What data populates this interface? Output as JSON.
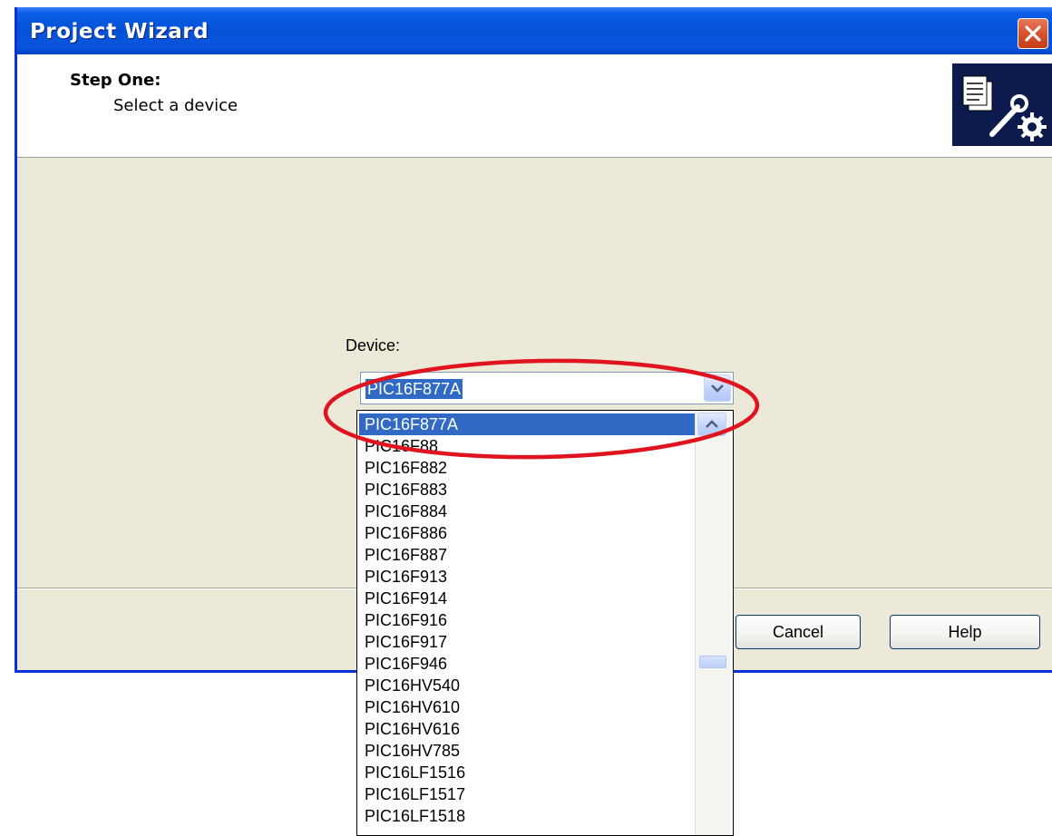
{
  "window": {
    "title": "Project Wizard"
  },
  "header": {
    "step_title": "Step One:",
    "step_subtitle": "Select a device"
  },
  "device_field": {
    "label": "Device:",
    "selected_value": "PIC16F877A"
  },
  "dropdown": {
    "items": [
      "PIC16F877A",
      "PIC16F88",
      "PIC16F882",
      "PIC16F883",
      "PIC16F884",
      "PIC16F886",
      "PIC16F887",
      "PIC16F913",
      "PIC16F914",
      "PIC16F916",
      "PIC16F917",
      "PIC16F946",
      "PIC16HV540",
      "PIC16HV610",
      "PIC16HV616",
      "PIC16HV785",
      "PIC16LF1516",
      "PIC16LF1517",
      "PIC16LF1518"
    ],
    "selected_index": 0
  },
  "buttons": {
    "cancel_label": "Cancel",
    "help_label": "Help"
  },
  "icons": {
    "close": "close-icon",
    "wizard": "wizard-tools-icon",
    "combo_arrow": "chevron-down-icon",
    "scroll_up": "chevron-up-icon"
  },
  "colors": {
    "title_bar": "#0451d6",
    "selection": "#316ac5",
    "annotation": "#e0141e"
  }
}
